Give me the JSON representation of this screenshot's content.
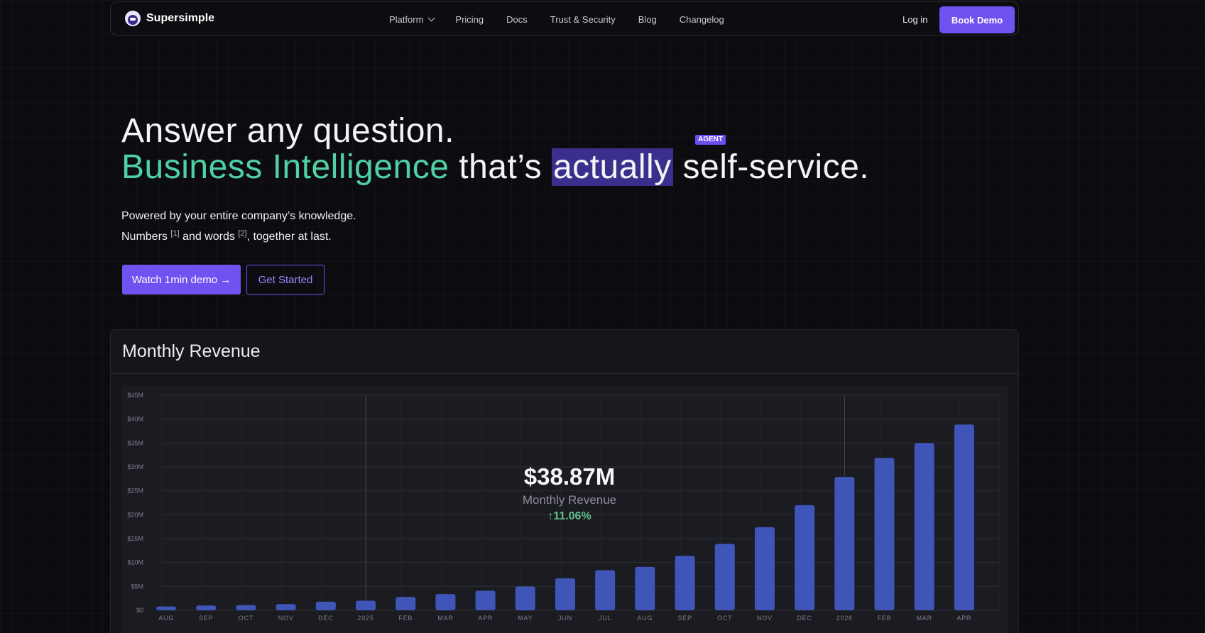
{
  "nav": {
    "brand": "Supersimple",
    "links": [
      "Platform",
      "Pricing",
      "Docs",
      "Trust & Security",
      "Blog",
      "Changelog"
    ],
    "login": "Log in",
    "cta": "Book Demo"
  },
  "hero": {
    "line1": "Answer any question.",
    "accent": "Business Intelligence",
    "mid": " that’s ",
    "highlight": "actually",
    "end": " self-service.",
    "tag": "AGENT",
    "sub1": "Powered by your entire company’s knowledge.",
    "sub2a": "Numbers ",
    "sup1": "[1]",
    "sub2b": " and words ",
    "sup2": "[2]",
    "sub2c": ", together at last.",
    "primary_btn": "Watch 1min demo →",
    "secondary_btn": "Get Started"
  },
  "card": {
    "title": "Monthly Revenue",
    "overlay_value": "$38.87M",
    "overlay_label": "Monthly Revenue",
    "overlay_change": "↑11.06%"
  },
  "chart_data": {
    "type": "bar",
    "categories": [
      "AUG",
      "SEP",
      "OCT",
      "NOV",
      "DEC",
      "2025",
      "FEB",
      "MAR",
      "APR",
      "MAY",
      "JUN",
      "JUL",
      "AUG",
      "SEP",
      "OCT",
      "NOV",
      "DEC",
      "2026",
      "FEB",
      "MAR",
      "APR"
    ],
    "values": [
      0.8,
      1.0,
      1.1,
      1.3,
      1.8,
      2.0,
      2.8,
      3.4,
      4.1,
      5.0,
      6.7,
      8.4,
      9.1,
      11.4,
      13.9,
      17.4,
      22.0,
      27.9,
      31.9,
      35.0,
      38.87
    ],
    "yticks": [
      "$0",
      "$5M",
      "$10M",
      "$15M",
      "$20M",
      "$25M",
      "$30M",
      "$35M",
      "$40M",
      "$45M"
    ],
    "ylim": [
      0,
      45
    ],
    "unit": "$M",
    "bar_color": "#3f55b8",
    "grid": true
  }
}
